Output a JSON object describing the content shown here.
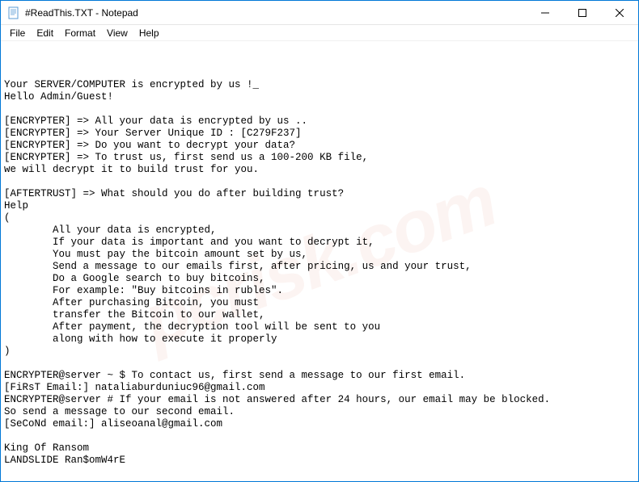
{
  "window": {
    "title": "#ReadThis.TXT - Notepad"
  },
  "menubar": {
    "file": "File",
    "edit": "Edit",
    "format": "Format",
    "view": "View",
    "help": "Help"
  },
  "content": {
    "lines": [
      "Your SERVER/COMPUTER is encrypted by us !_",
      "Hello Admin/Guest!",
      "",
      "[ENCRYPTER] => All your data is encrypted by us ..",
      "[ENCRYPTER] => Your Server Unique ID : [C279F237]",
      "[ENCRYPTER] => Do you want to decrypt your data?",
      "[ENCRYPTER] => To trust us, first send us a 100-200 KB file,",
      "we will decrypt it to build trust for you.",
      "",
      "[AFTERTRUST] => What should you do after building trust?",
      "Help",
      "(",
      "        All your data is encrypted,",
      "        If your data is important and you want to decrypt it,",
      "        You must pay the bitcoin amount set by us,",
      "        Send a message to our emails first, after pricing, us and your trust,",
      "        Do a Google search to buy bitcoins,",
      "        For example: \"Buy bitcoins in rubles\".",
      "        After purchasing Bitcoin, you must",
      "        transfer the Bitcoin to our wallet,",
      "        After payment, the decryption tool will be sent to you",
      "        along with how to execute it properly",
      ")",
      "",
      "ENCRYPTER@server ~ $ To contact us, first send a message to our first email.",
      "[FiRsT Email:] nataliaburduniuc96@gmail.com",
      "ENCRYPTER@server # If your email is not answered after 24 hours, our email may be blocked.",
      "So send a message to our second email.",
      "[SeCoNd email:] aliseoanal@gmail.com",
      "",
      "King Of Ransom",
      "LANDSLIDE Ran$omW4rE"
    ]
  },
  "watermark": "pcrisk.com"
}
